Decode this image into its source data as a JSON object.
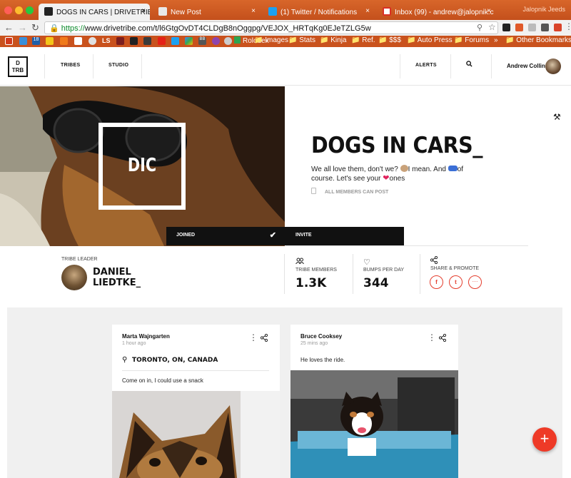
{
  "browser": {
    "tabs": [
      {
        "title": "DOGS IN CARS | DRIVETRIBE",
        "close": "×",
        "favicon_color": "#222222"
      },
      {
        "title": "New Post",
        "close": "×",
        "favicon_color": "#d0d0d0"
      },
      {
        "title": "(1) Twitter / Notifications",
        "close": "×",
        "favicon_color": "#1da1f2"
      },
      {
        "title": "Inbox (99) - andrew@jalopnik.c",
        "close": "×",
        "favicon_color": "#d93025"
      }
    ],
    "profile_label": "Jalopnik Jeeds",
    "url_scheme": "https://",
    "url_rest": "www.drivetribe.com/t/l6GtgOvDT4CLDgB8nOggpg/VEJOX_HRTqKg0EJeTZLG5w",
    "bookmarks": [
      {
        "label": "Rolodex",
        "icon": "rolodex-icon"
      },
      {
        "label": "Images",
        "icon": "folder-icon"
      },
      {
        "label": "Stats",
        "icon": "folder-icon"
      },
      {
        "label": "Kinja",
        "icon": "folder-icon"
      },
      {
        "label": "Ref.",
        "icon": "folder-icon"
      },
      {
        "label": "$$$",
        "icon": "folder-icon"
      },
      {
        "label": "Auto Press",
        "icon": "folder-icon"
      },
      {
        "label": "Forums",
        "icon": "folder-icon"
      },
      {
        "label": "Other Bookmarks",
        "icon": "folder-icon"
      }
    ],
    "bookmark_icon_labels": [
      "18",
      "LS",
      "BB"
    ],
    "more_chevron": "»"
  },
  "header": {
    "logo_line1": "D",
    "logo_line2": "TRB",
    "nav": [
      "TRIBES",
      "STUDIO"
    ],
    "alerts": "ALERTS",
    "user_name": "Andrew Collins"
  },
  "hero": {
    "image_overlay_text": "DIC",
    "joined_label": "JOINED",
    "invite_label": "INVITE",
    "title": "DOGS IN CARS_",
    "description_part1": "We all love them, don't we?",
    "description_part2": "I mean. And",
    "description_part3": "of course. Let's see your",
    "description_part4": "ones",
    "permission": "ALL MEMBERS CAN POST"
  },
  "stats": {
    "leader_label": "TRIBE LEADER",
    "leader_first": "DANIEL",
    "leader_last": "LIEDTKE_",
    "members_label": "TRIBE MEMBERS",
    "members_value": "1.3K",
    "bumps_label": "BUMPS PER DAY",
    "bumps_value": "344",
    "share_label": "SHARE & PROMOTE",
    "share_buttons": [
      "f",
      "t",
      "···"
    ]
  },
  "posts": [
    {
      "author": "Marta Wajngarten",
      "time": "1 hour ago",
      "location": "TORONTO, ON, CANADA",
      "text": "Come on in, I could use a snack"
    },
    {
      "author": "Bruce Cooksey",
      "time": "25 mins ago",
      "text": "He loves the ride."
    }
  ],
  "fab": "+",
  "colors": {
    "accent": "#ee3a27",
    "chrome": "#c8531f"
  }
}
